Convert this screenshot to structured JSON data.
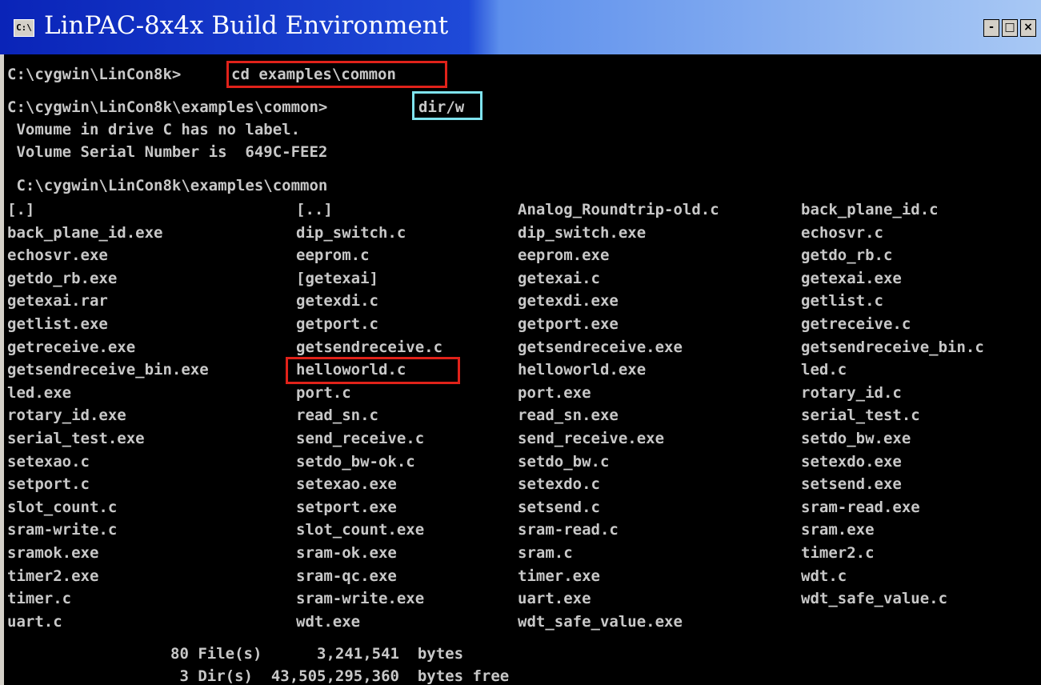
{
  "window": {
    "icon_text": "C:\\",
    "title": "LinPAC-8x4x Build Environment",
    "minimize": "-",
    "maximize": "□",
    "close": "×"
  },
  "console": {
    "cmd1_prompt": "C:\\cygwin\\LinCon8k>",
    "cmd1": "cd examples\\common",
    "cmd2_prompt": "C:\\cygwin\\LinCon8k\\examples\\common>",
    "cmd2": "dir/w",
    "vol_label": " Vomume in drive C has no label.",
    "vol_serial": " Volume Serial Number is  649C-FEE2",
    "dir_header": " C:\\cygwin\\LinCon8k\\examples\\common",
    "files": [
      [
        "[.]",
        "[..]",
        "Analog_Roundtrip-old.c",
        "back_plane_id.c"
      ],
      [
        "back_plane_id.exe",
        "dip_switch.c",
        "dip_switch.exe",
        "echosvr.c"
      ],
      [
        "echosvr.exe",
        "eeprom.c",
        "eeprom.exe",
        "getdo_rb.c"
      ],
      [
        "getdo_rb.exe",
        "[getexai]",
        "getexai.c",
        "getexai.exe"
      ],
      [
        "getexai.rar",
        "getexdi.c",
        "getexdi.exe",
        "getlist.c"
      ],
      [
        "getlist.exe",
        "getport.c",
        "getport.exe",
        "getreceive.c"
      ],
      [
        "getreceive.exe",
        "getsendreceive.c",
        "getsendreceive.exe",
        "getsendreceive_bin.c"
      ],
      [
        "getsendreceive_bin.exe",
        "helloworld.c",
        "helloworld.exe",
        "led.c"
      ],
      [
        "led.exe",
        "port.c",
        "port.exe",
        "rotary_id.c"
      ],
      [
        "rotary_id.exe",
        "read_sn.c",
        "read_sn.exe",
        "serial_test.c"
      ],
      [
        "serial_test.exe",
        "send_receive.c",
        "send_receive.exe",
        "setdo_bw.exe"
      ],
      [
        "setexao.c",
        "setdo_bw-ok.c",
        "setdo_bw.c",
        "setexdo.exe"
      ],
      [
        "setport.c",
        "setexao.exe",
        "setexdo.c",
        "setsend.exe"
      ],
      [
        "slot_count.c",
        "setport.exe",
        "setsend.c",
        "sram-read.exe"
      ],
      [
        "sram-write.c",
        "slot_count.exe",
        "sram-read.c",
        "sram.exe"
      ],
      [
        "sramok.exe",
        "sram-ok.exe",
        "sram.c",
        "timer2.c"
      ],
      [
        "timer2.exe",
        "sram-qc.exe",
        "timer.exe",
        "wdt.c"
      ],
      [
        "timer.c",
        "sram-write.exe",
        "uart.exe",
        "wdt_safe_value.c"
      ],
      [
        "uart.c",
        "wdt.exe",
        "wdt_safe_value.exe",
        ""
      ]
    ],
    "summary_files": "80 File(s)      3,241,541  bytes",
    "summary_dirs": " 3 Dir(s)  43,505,295,360  bytes free"
  }
}
